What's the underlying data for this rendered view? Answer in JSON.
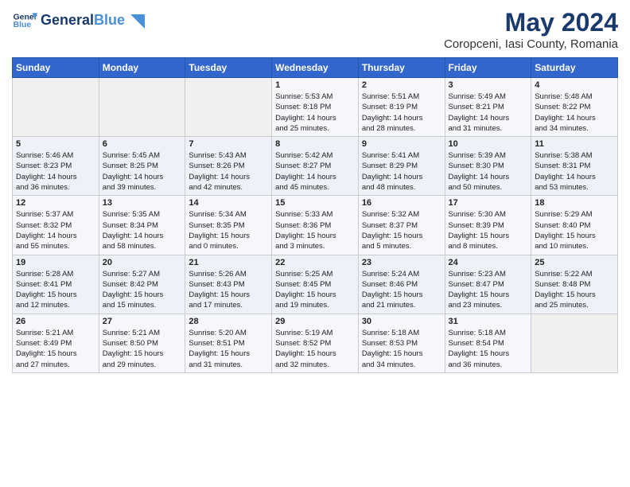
{
  "header": {
    "logo_general": "General",
    "logo_blue": "Blue",
    "month": "May 2024",
    "location": "Coropceni, Iasi County, Romania"
  },
  "weekdays": [
    "Sunday",
    "Monday",
    "Tuesday",
    "Wednesday",
    "Thursday",
    "Friday",
    "Saturday"
  ],
  "weeks": [
    [
      {
        "day": "",
        "info": ""
      },
      {
        "day": "",
        "info": ""
      },
      {
        "day": "",
        "info": ""
      },
      {
        "day": "1",
        "info": "Sunrise: 5:53 AM\nSunset: 8:18 PM\nDaylight: 14 hours\nand 25 minutes."
      },
      {
        "day": "2",
        "info": "Sunrise: 5:51 AM\nSunset: 8:19 PM\nDaylight: 14 hours\nand 28 minutes."
      },
      {
        "day": "3",
        "info": "Sunrise: 5:49 AM\nSunset: 8:21 PM\nDaylight: 14 hours\nand 31 minutes."
      },
      {
        "day": "4",
        "info": "Sunrise: 5:48 AM\nSunset: 8:22 PM\nDaylight: 14 hours\nand 34 minutes."
      }
    ],
    [
      {
        "day": "5",
        "info": "Sunrise: 5:46 AM\nSunset: 8:23 PM\nDaylight: 14 hours\nand 36 minutes."
      },
      {
        "day": "6",
        "info": "Sunrise: 5:45 AM\nSunset: 8:25 PM\nDaylight: 14 hours\nand 39 minutes."
      },
      {
        "day": "7",
        "info": "Sunrise: 5:43 AM\nSunset: 8:26 PM\nDaylight: 14 hours\nand 42 minutes."
      },
      {
        "day": "8",
        "info": "Sunrise: 5:42 AM\nSunset: 8:27 PM\nDaylight: 14 hours\nand 45 minutes."
      },
      {
        "day": "9",
        "info": "Sunrise: 5:41 AM\nSunset: 8:29 PM\nDaylight: 14 hours\nand 48 minutes."
      },
      {
        "day": "10",
        "info": "Sunrise: 5:39 AM\nSunset: 8:30 PM\nDaylight: 14 hours\nand 50 minutes."
      },
      {
        "day": "11",
        "info": "Sunrise: 5:38 AM\nSunset: 8:31 PM\nDaylight: 14 hours\nand 53 minutes."
      }
    ],
    [
      {
        "day": "12",
        "info": "Sunrise: 5:37 AM\nSunset: 8:32 PM\nDaylight: 14 hours\nand 55 minutes."
      },
      {
        "day": "13",
        "info": "Sunrise: 5:35 AM\nSunset: 8:34 PM\nDaylight: 14 hours\nand 58 minutes."
      },
      {
        "day": "14",
        "info": "Sunrise: 5:34 AM\nSunset: 8:35 PM\nDaylight: 15 hours\nand 0 minutes."
      },
      {
        "day": "15",
        "info": "Sunrise: 5:33 AM\nSunset: 8:36 PM\nDaylight: 15 hours\nand 3 minutes."
      },
      {
        "day": "16",
        "info": "Sunrise: 5:32 AM\nSunset: 8:37 PM\nDaylight: 15 hours\nand 5 minutes."
      },
      {
        "day": "17",
        "info": "Sunrise: 5:30 AM\nSunset: 8:39 PM\nDaylight: 15 hours\nand 8 minutes."
      },
      {
        "day": "18",
        "info": "Sunrise: 5:29 AM\nSunset: 8:40 PM\nDaylight: 15 hours\nand 10 minutes."
      }
    ],
    [
      {
        "day": "19",
        "info": "Sunrise: 5:28 AM\nSunset: 8:41 PM\nDaylight: 15 hours\nand 12 minutes."
      },
      {
        "day": "20",
        "info": "Sunrise: 5:27 AM\nSunset: 8:42 PM\nDaylight: 15 hours\nand 15 minutes."
      },
      {
        "day": "21",
        "info": "Sunrise: 5:26 AM\nSunset: 8:43 PM\nDaylight: 15 hours\nand 17 minutes."
      },
      {
        "day": "22",
        "info": "Sunrise: 5:25 AM\nSunset: 8:45 PM\nDaylight: 15 hours\nand 19 minutes."
      },
      {
        "day": "23",
        "info": "Sunrise: 5:24 AM\nSunset: 8:46 PM\nDaylight: 15 hours\nand 21 minutes."
      },
      {
        "day": "24",
        "info": "Sunrise: 5:23 AM\nSunset: 8:47 PM\nDaylight: 15 hours\nand 23 minutes."
      },
      {
        "day": "25",
        "info": "Sunrise: 5:22 AM\nSunset: 8:48 PM\nDaylight: 15 hours\nand 25 minutes."
      }
    ],
    [
      {
        "day": "26",
        "info": "Sunrise: 5:21 AM\nSunset: 8:49 PM\nDaylight: 15 hours\nand 27 minutes."
      },
      {
        "day": "27",
        "info": "Sunrise: 5:21 AM\nSunset: 8:50 PM\nDaylight: 15 hours\nand 29 minutes."
      },
      {
        "day": "28",
        "info": "Sunrise: 5:20 AM\nSunset: 8:51 PM\nDaylight: 15 hours\nand 31 minutes."
      },
      {
        "day": "29",
        "info": "Sunrise: 5:19 AM\nSunset: 8:52 PM\nDaylight: 15 hours\nand 32 minutes."
      },
      {
        "day": "30",
        "info": "Sunrise: 5:18 AM\nSunset: 8:53 PM\nDaylight: 15 hours\nand 34 minutes."
      },
      {
        "day": "31",
        "info": "Sunrise: 5:18 AM\nSunset: 8:54 PM\nDaylight: 15 hours\nand 36 minutes."
      },
      {
        "day": "",
        "info": ""
      }
    ]
  ]
}
